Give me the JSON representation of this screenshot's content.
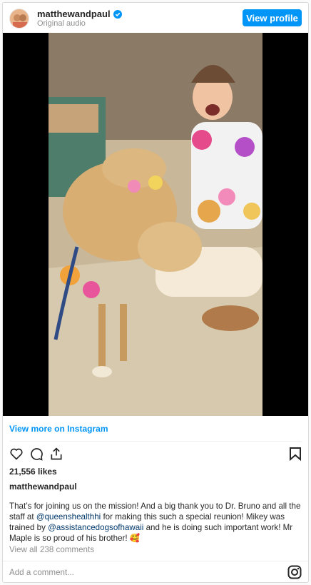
{
  "header": {
    "username": "matthewandpaul",
    "subtitle": "Original audio",
    "view_profile_label": "View profile"
  },
  "media": {
    "icon": "video-still"
  },
  "view_more_label": "View more on Instagram",
  "likes": "21,556 likes",
  "caption": {
    "username": "matthewandpaul",
    "text_1": "That’s for joining us on the mission! And a big thank you to Dr. Bruno and all the staff at ",
    "mention_1": "@queenshealthhi",
    "text_2": " for making this such a special reunion! Mikey was trained by ",
    "mention_2": "@assistancedogsofhawaii",
    "text_3": " and he is doing such important work! Mr Maple is so proud of his brother! 🥰"
  },
  "comments_link": "View all 238 comments",
  "add_comment_placeholder": "Add a comment...",
  "colors": {
    "accent": "#0095f6",
    "mention": "#00376b",
    "muted": "#8e8e8e"
  }
}
